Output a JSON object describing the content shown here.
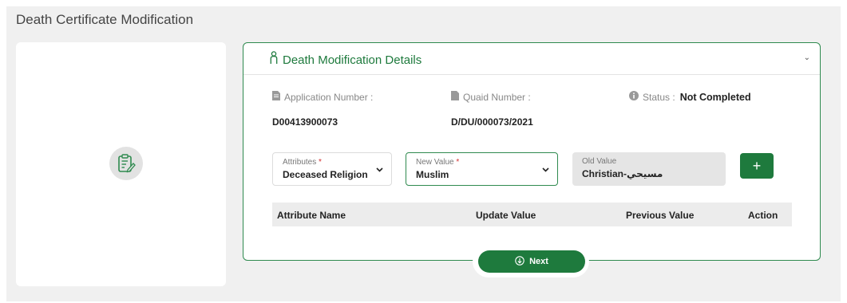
{
  "page": {
    "title": "Death Certificate Modification"
  },
  "card": {
    "title": "Death Modification Details"
  },
  "info": {
    "application_label": "Application Number :",
    "application_value": "D00413900073",
    "quaid_label": "Quaid Number :",
    "quaid_value": "D/DU/000073/2021",
    "status_label": "Status :",
    "status_value": "Not Completed"
  },
  "form": {
    "attributes": {
      "label": "Attributes",
      "required": "*",
      "value": "Deceased Religion"
    },
    "new_value": {
      "label": "New Value",
      "required": "*",
      "value": "Muslim"
    },
    "old_value": {
      "label": "Old Value",
      "value": "Christian-مسيحي"
    },
    "add_label": "+"
  },
  "table": {
    "columns": [
      "Attribute Name",
      "Update Value",
      "Previous Value",
      "Action"
    ]
  },
  "next_label": "Next",
  "colors": {
    "accent": "#1e7a3d",
    "border": "#2f8a4f",
    "required": "#d32f2f"
  }
}
